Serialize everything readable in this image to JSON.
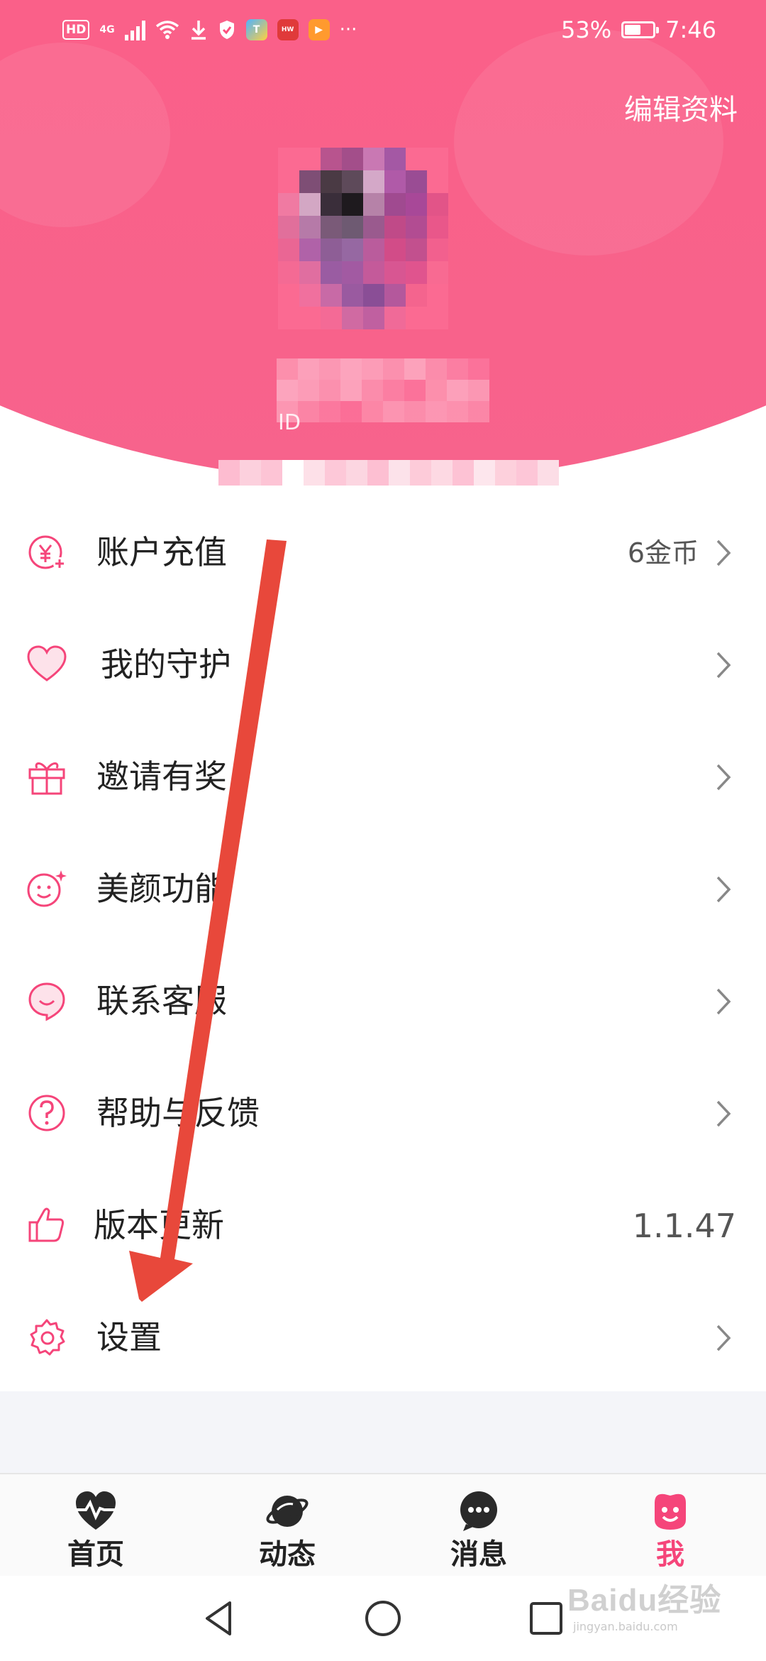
{
  "status_bar": {
    "left_badge": "HD",
    "network": "4G",
    "battery_percent": "53%",
    "time": "7:46",
    "more": "···"
  },
  "header": {
    "edit_profile": "编辑资料",
    "id_prefix": "ID"
  },
  "menu": {
    "items": [
      {
        "label": "账户充值",
        "value": "6金币",
        "icon": "yuan-plus-icon"
      },
      {
        "label": "我的守护",
        "value": "",
        "icon": "heart-icon"
      },
      {
        "label": "邀请有奖",
        "value": "",
        "icon": "gift-icon"
      },
      {
        "label": "美颜功能",
        "value": "",
        "icon": "sparkle-face-icon"
      },
      {
        "label": "联系客服",
        "value": "",
        "icon": "chat-smile-icon"
      },
      {
        "label": "帮助与反馈",
        "value": "",
        "icon": "question-icon"
      },
      {
        "label": "版本更新",
        "value": "1.1.47",
        "icon": "thumbs-up-icon"
      },
      {
        "label": "设置",
        "value": "",
        "icon": "gear-icon"
      }
    ]
  },
  "bottom_nav": {
    "tabs": [
      {
        "label": "首页",
        "icon": "heartbeat-icon",
        "active": false
      },
      {
        "label": "动态",
        "icon": "planet-icon",
        "active": false
      },
      {
        "label": "消息",
        "icon": "chat-dots-icon",
        "active": false
      },
      {
        "label": "我",
        "icon": "smile-face-icon",
        "active": true
      }
    ]
  },
  "watermark": {
    "logo": "Baidu经验",
    "sub": "jingyan.baidu.com"
  },
  "colors": {
    "brand_pink": "#fd4f7e",
    "active_tab": "#f5457a",
    "annotation_arrow": "#e8483b"
  }
}
